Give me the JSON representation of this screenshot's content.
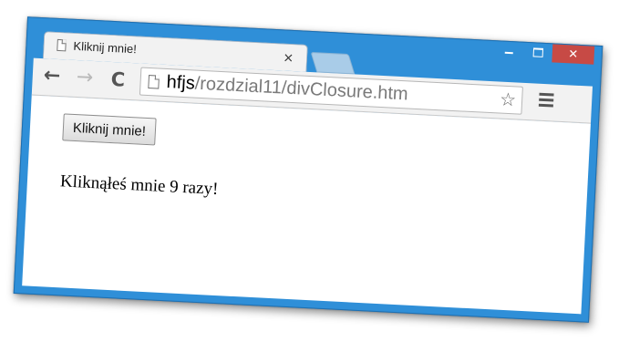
{
  "window": {
    "caption": {
      "minimize_icon": "minimize-icon",
      "maximize_icon": "maximize-icon",
      "close_icon": "close-icon",
      "close_glyph": "✕",
      "close_color": "#c74a45"
    },
    "frame_color": "#2f8fd8"
  },
  "tab": {
    "title": "Kliknij mnie!",
    "icon": "page-icon",
    "close_glyph": "×"
  },
  "toolbar": {
    "back_glyph": "←",
    "forward_glyph": "→",
    "reload_glyph": "C",
    "url_host": "hfjs",
    "url_path": "/rozdzial11/divClosure.htm",
    "star_glyph": "☆",
    "menu_icon": "menu-icon"
  },
  "page": {
    "button_label": "Kliknij mnie!",
    "result_text": "Kliknąłeś mnie 9 razy!"
  }
}
